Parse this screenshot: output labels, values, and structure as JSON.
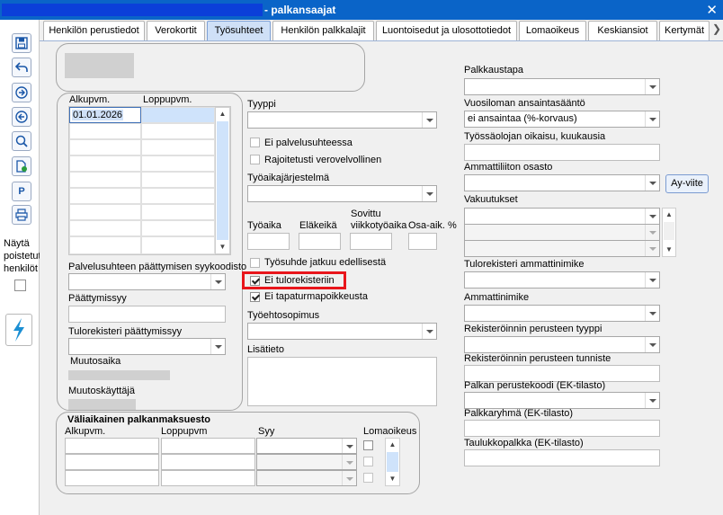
{
  "window": {
    "title": "- palkansaajat",
    "close_label": "✕"
  },
  "tabs": [
    {
      "label": "Henkilön perustiedot"
    },
    {
      "label": "Verokortit"
    },
    {
      "label": "Työsuhteet"
    },
    {
      "label": "Henkilön palkkalajit"
    },
    {
      "label": "Luontoisedut ja ulosottotiedot"
    },
    {
      "label": "Lomaoikeus"
    },
    {
      "label": "Keskiansiot"
    },
    {
      "label": "Kertymät"
    }
  ],
  "tab_scroll": "❯",
  "leftbar": {
    "p_button": "P",
    "nayta": [
      "Näytä",
      "poistetut",
      "henkilöt"
    ]
  },
  "employment_list": {
    "col_start": "Alkupvm.",
    "col_end": "Loppupvm.",
    "rows": [
      {
        "start": "01.01.2026",
        "end": ""
      }
    ]
  },
  "left_fields": {
    "termination_reason_label": "Palvelusuhteen päättymisen syykoodisto",
    "end_date_label": "Päättymissyy",
    "income_register_end_label": "Tulorekisteri päättymissyy",
    "modified_time_label": "Muutosaika",
    "modified_user_label": "Muutoskäyttäjä"
  },
  "middle": {
    "type_label": "Tyyppi",
    "not_in_service_label": "Ei palvelusuhteessa",
    "limited_tax_label": "Rajoitetusti verovelvollinen",
    "work_time_system_label": "Työaikajärjestelmä",
    "work_time_label": "Työaika",
    "pension_age_label": "Eläkeikä",
    "agreed_weekly_label": [
      "Sovittu",
      "viikkotyöaika"
    ],
    "part_time_label": "Osa-aik. %",
    "continues_label": "Työsuhde jatkuu edellisestä",
    "no_income_register_label": "Ei tulorekisteriin",
    "no_accident_insurance_label": "Ei tapaturmapoikkeusta",
    "contract_label": "Työehtosopimus",
    "extra_info_label": "Lisätieto"
  },
  "temp_pay": {
    "title": "Väliaikainen palkanmaksuesto",
    "col_start": "Alkupvm.",
    "col_end": "Loppupvm",
    "col_reason": "Syy",
    "col_holiday": "Lomaoikeus"
  },
  "right": {
    "payment_method_label": "Palkkaustapa",
    "holiday_rule_label": "Vuosiloman ansaintasääntö",
    "holiday_rule_value": "ei ansaintaa (%-korvaus)",
    "employer_right_label": "Työssäolojan oikaisu, kuukausia",
    "union_label": "Ammattiliiton osasto",
    "union_button": "Ay-viite",
    "insurance_label": "Vakuutukset",
    "ir_occupation_label": "Tulorekisteri ammattinimike",
    "occupation_label": "Ammattinimike",
    "basis_type_label": "Rekisteröinnin perusteen tyyppi",
    "basis_id_label": "Rekisteröinnin perusteen tunniste",
    "pay_code_label": "Palkan perustekoodi (EK-tilasto)",
    "pay_group_label": "Palkkaryhmä (EK-tilasto)",
    "pay_table_label": "Taulukkopalkka (EK-tilasto)"
  }
}
